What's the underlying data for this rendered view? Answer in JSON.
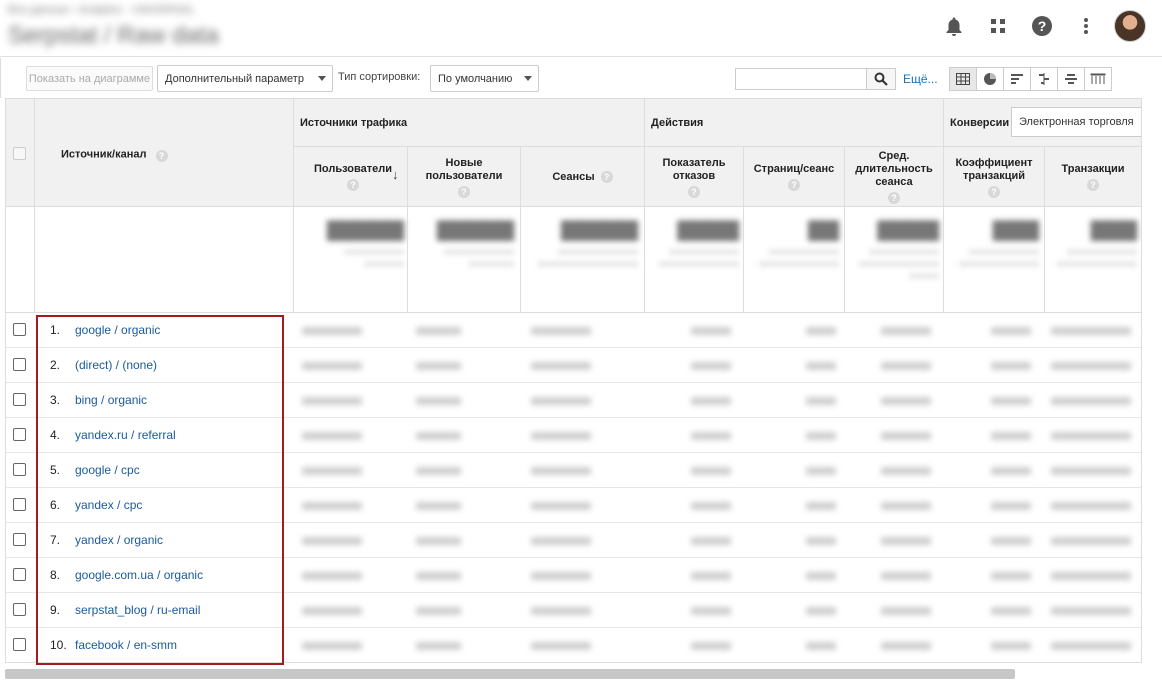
{
  "header": {
    "breadcrumb": "Все данные › Analytics · UNIVERSAL",
    "title": "Serpstat / Raw data"
  },
  "toolbar": {
    "plot_button": "Показать на диаграмме",
    "secondary_dimension": "Дополнительный параметр",
    "sort_type_label": "Тип сортировки:",
    "sort_type_value": "По умолчанию",
    "search_value": "",
    "more_link": "Ещё..."
  },
  "table": {
    "groups": {
      "traffic_sources": "Источники трафика",
      "actions": "Действия",
      "conversions": "Конверсии",
      "conversions_select": "Электронная торговля"
    },
    "columns": {
      "source_medium": "Источник/канал",
      "users": "Пользователи",
      "new_users": "Новые пользователи",
      "sessions": "Сеансы",
      "bounce_rate": "Показатель отказов",
      "pages_per_session": "Страниц/сеанс",
      "avg_session_duration": "Сред. длительность сеанса",
      "conversion_rate": "Коэффициент транзакций",
      "transactions": "Транзакции"
    },
    "rows": [
      {
        "n": "1.",
        "source": "google / organic"
      },
      {
        "n": "2.",
        "source": "(direct) / (none)"
      },
      {
        "n": "3.",
        "source": "bing / organic"
      },
      {
        "n": "4.",
        "source": "yandex.ru / referral"
      },
      {
        "n": "5.",
        "source": "google / cpc"
      },
      {
        "n": "6.",
        "source": "yandex / cpc"
      },
      {
        "n": "7.",
        "source": "yandex / organic"
      },
      {
        "n": "8.",
        "source": "google.com.ua / organic"
      },
      {
        "n": "9.",
        "source": "serpstat_blog / ru-email"
      },
      {
        "n": "10.",
        "source": "facebook / en-smm"
      }
    ],
    "help_glyph": "?",
    "sort_glyph": "↓"
  },
  "colors": {
    "link": "#1a5a9c",
    "highlight_border": "#a31b1b"
  },
  "icons": [
    "bell-icon",
    "apps-icon",
    "help-icon",
    "more-vert-icon",
    "search-icon",
    "table-view-icon",
    "pie-view-icon",
    "performance-view-icon",
    "comparison-view-icon",
    "term-cloud-view-icon",
    "pivot-view-icon"
  ]
}
